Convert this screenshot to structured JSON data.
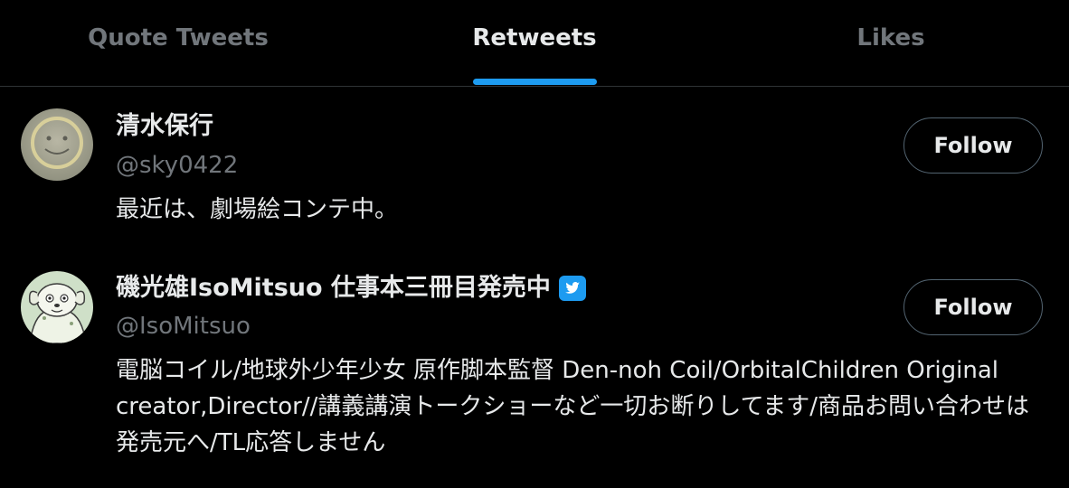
{
  "tabs": [
    {
      "label": "Quote Tweets",
      "active": false
    },
    {
      "label": "Retweets",
      "active": true
    },
    {
      "label": "Likes",
      "active": false
    }
  ],
  "colors": {
    "background": "#000000",
    "accent": "#1d9bf0",
    "text_primary": "#e7e9ea",
    "text_secondary": "#71767b",
    "border": "#2f3336"
  },
  "users": [
    {
      "display_name": "清水保行",
      "handle": "@sky0422",
      "bio": "最近は、劇場絵コンテ中。",
      "follow_label": "Follow",
      "avatar_icon": "smiley-face-avatar"
    },
    {
      "display_name": "磯光雄IsoMitsuo 仕事本三冊目発売中",
      "handle": "@IsoMitsuo",
      "bio": "電脳コイル/地球外少年少女 原作脚本監督 Den-noh Coil/OrbitalChildren Original creator,Director//講義講演トークショーなど一切お断りしてます/商品お問い合わせは発売元へ/TL応答しません",
      "follow_label": "Follow",
      "avatar_icon": "cartoon-dog-avatar",
      "badge_icon": "twitter-bird-badge-icon"
    }
  ]
}
